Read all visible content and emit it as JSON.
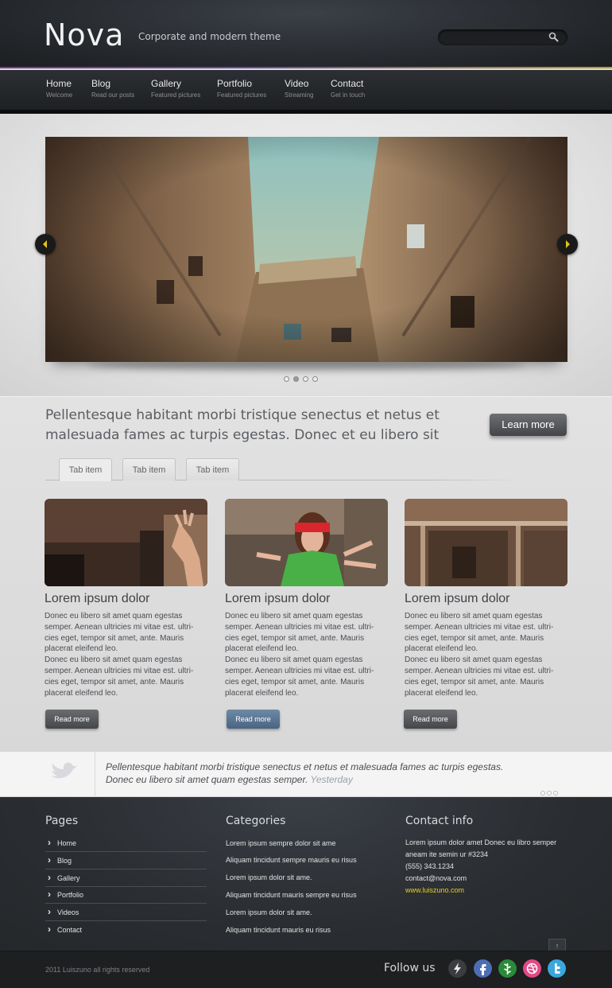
{
  "header": {
    "logo": "Nova",
    "tagline": "Corporate and modern theme",
    "search_placeholder": ""
  },
  "nav": [
    {
      "label": "Home",
      "sub": "Welcome"
    },
    {
      "label": "Blog",
      "sub": "Read our posts"
    },
    {
      "label": "Gallery",
      "sub": "Featured pictures"
    },
    {
      "label": "Portfolio",
      "sub": "Featured pictures"
    },
    {
      "label": "Video",
      "sub": "Streaming"
    },
    {
      "label": "Contact",
      "sub": "Get in touch"
    }
  ],
  "intro": {
    "text": "Pellentesque habitant morbi tristique senectus et netus et malesuada fames ac turpis egestas. Donec  et eu libero sit",
    "button": "Learn more"
  },
  "tabs": [
    "Tab item",
    "Tab item",
    "Tab item"
  ],
  "cards": [
    {
      "title": "Lorem ipsum dolor",
      "p1": "Donec eu libero sit amet quam egestas semper. Aenean ultricies mi vitae est. ultri-cies eget, tempor sit amet, ante. Mauris placerat eleifend leo.",
      "p2": "Donec eu libero sit amet quam egestas semper. Aenean ultricies mi vitae est. ultri-cies eget, tempor sit amet, ante. Mauris placerat eleifend leo.",
      "button": "Read more"
    },
    {
      "title": "Lorem ipsum dolor",
      "p1": "Donec eu libero sit amet quam egestas semper. Aenean ultricies mi vitae est. ultri-cies eget, tempor sit amet, ante. Mauris placerat eleifend leo.",
      "p2": "Donec eu libero sit amet quam egestas semper. Aenean ultricies mi vitae est. ultri-cies eget, tempor sit amet, ante. Mauris placerat eleifend leo.",
      "button": "Read more"
    },
    {
      "title": "Lorem ipsum dolor",
      "p1": "Donec eu libero sit amet quam egestas semper. Aenean ultricies mi vitae est. ultri-cies eget, tempor sit amet, ante. Mauris placerat eleifend leo.",
      "p2": "Donec eu libero sit amet quam egestas semper. Aenean ultricies mi vitae est. ultri-cies eget, tempor sit amet, ante. Mauris placerat eleifend leo.",
      "button": "Read more"
    }
  ],
  "tweet": {
    "text": "Pellentesque habitant morbi tristique senectus et netus et malesuada fames ac turpis egestas. Donec eu libero sit amet quam egestas semper.",
    "time": "Yesterday"
  },
  "footer": {
    "pages_heading": "Pages",
    "pages": [
      "Home",
      "Blog",
      "Gallery",
      "Portfolio",
      "Videos",
      "Contact"
    ],
    "categories_heading": "Categories",
    "categories": [
      "Lorem ipsum sempre dolor sit ame",
      "Aliquam tincidunt sempre mauris eu risus",
      "Lorem ipsum dolor sit ame.",
      "Aliquam tincidunt mauris  sempre eu risus",
      "Lorem ipsum dolor sit ame.",
      "Aliquam tincidunt mauris eu risus"
    ],
    "contact_heading": "Contact info",
    "contact_address": "Lorem ipsum dolor amet Donec eu libro semper aneam ite semin ur  #3234",
    "contact_phone": "(555) 343.1234",
    "contact_email": "contact@nova.com",
    "contact_web": "www.luiszuno.com",
    "up_arrow": "↑"
  },
  "bottom": {
    "copyright": "2011 Luiszuno all rights reserved",
    "follow": "Follow us"
  },
  "colors": {
    "accent_purple": "#6b3a8a",
    "link_yellow": "#e6d21a"
  }
}
